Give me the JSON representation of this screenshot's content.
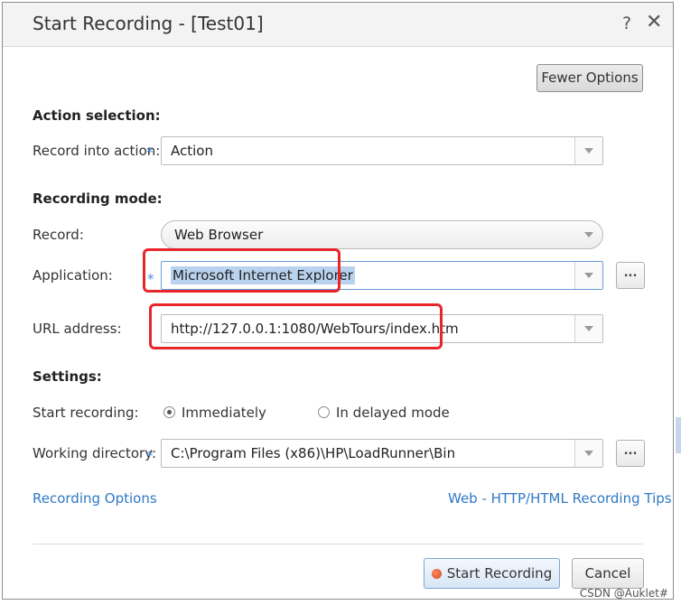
{
  "window": {
    "title": "Start Recording - [Test01]",
    "help_symbol": "?",
    "close_symbol": "✕"
  },
  "options_toggle_label": "Fewer Options",
  "action_selection": {
    "heading": "Action selection:",
    "record_into_label": "Record into action:",
    "record_into_value": "Action"
  },
  "recording_mode": {
    "heading": "Recording mode:",
    "record_label": "Record:",
    "record_value": "Web Browser",
    "application_label": "Application:",
    "application_value": "Microsoft Internet Explorer",
    "url_label": "URL address:",
    "url_value": "http://127.0.0.1:1080/WebTours/index.htm"
  },
  "settings": {
    "heading": "Settings:",
    "start_recording_label": "Start recording:",
    "immediately_label": "Immediately",
    "delayed_label": "In delayed mode",
    "selected_mode": "Immediately",
    "working_dir_label": "Working directory:",
    "working_dir_value": "C:\\Program Files (x86)\\HP\\LoadRunner\\Bin"
  },
  "required_marker": "*",
  "browse_label": "...",
  "links": {
    "recording_options": "Recording Options",
    "tips": "Web - HTTP/HTML Recording Tips"
  },
  "footer": {
    "start_label": "Start Recording",
    "cancel_label": "Cancel"
  },
  "watermark": "CSDN @Auklet#",
  "colors": {
    "link": "#2f78c6",
    "required": "#4a90d9",
    "annotation": "#e8262a",
    "selection": "#b9d3ef"
  }
}
